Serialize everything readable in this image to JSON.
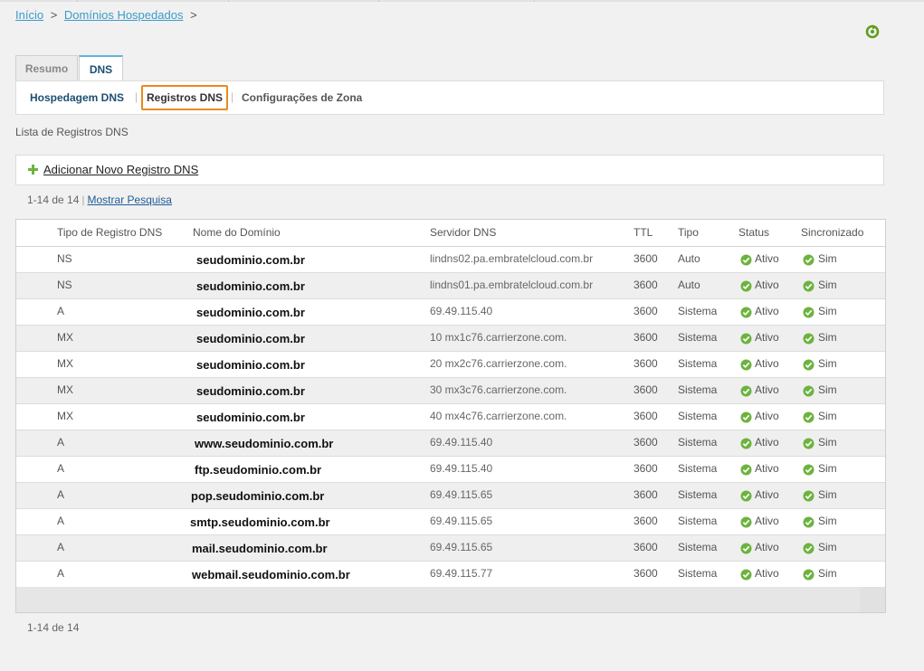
{
  "breadcrumb": {
    "items": [
      "Início",
      "Domínios Hospedados"
    ],
    "separator": ">"
  },
  "icons": {
    "refresh": "refresh-icon",
    "add": "plus-icon",
    "status_ok": "check-circle-icon"
  },
  "colors": {
    "link": "#3a9bc9",
    "tab_active_text": "#1d4f73",
    "highlight_border": "#e98a1b",
    "ok_green": "#6db33f"
  },
  "tabs": [
    {
      "label": "Resumo",
      "active": false
    },
    {
      "label": "DNS",
      "active": true
    }
  ],
  "subnav": {
    "items": [
      {
        "label": "Hospedagem DNS",
        "active": false
      },
      {
        "label": "Registros DNS",
        "active": true
      },
      {
        "label": "Configurações de Zona",
        "active": false
      }
    ],
    "separator": "|"
  },
  "list_title": "Lista de Registros DNS",
  "add_record_label": "Adicionar Novo Registro DNS",
  "paging": {
    "range": "1-14 de 14",
    "separator": "|",
    "search_link": "Mostrar Pesquisa",
    "bottom_range": "1-14 de 14"
  },
  "table": {
    "columns": [
      "Tipo de Registro DNS",
      "Nome do Domínio",
      "Servidor DNS",
      "TTL",
      "Tipo",
      "Status",
      "Sincronizado"
    ],
    "rows": [
      {
        "type": "NS",
        "name": "seudominio.com.br",
        "server": "lindns02.pa.embratelcloud.com.br",
        "ttl": "3600",
        "kind": "Auto",
        "status": "Ativo",
        "sync": "Sim"
      },
      {
        "type": "NS",
        "name": "seudominio.com.br",
        "server": "lindns01.pa.embratelcloud.com.br",
        "ttl": "3600",
        "kind": "Auto",
        "status": "Ativo",
        "sync": "Sim"
      },
      {
        "type": "A",
        "name": "seudominio.com.br",
        "server": "69.49.115.40",
        "ttl": "3600",
        "kind": "Sistema",
        "status": "Ativo",
        "sync": "Sim"
      },
      {
        "type": "MX",
        "name": "seudominio.com.br",
        "server": "10 mx1c76.carrierzone.com.",
        "ttl": "3600",
        "kind": "Sistema",
        "status": "Ativo",
        "sync": "Sim"
      },
      {
        "type": "MX",
        "name": "seudominio.com.br",
        "server": "20 mx2c76.carrierzone.com.",
        "ttl": "3600",
        "kind": "Sistema",
        "status": "Ativo",
        "sync": "Sim"
      },
      {
        "type": "MX",
        "name": "seudominio.com.br",
        "server": "30 mx3c76.carrierzone.com.",
        "ttl": "3600",
        "kind": "Sistema",
        "status": "Ativo",
        "sync": "Sim"
      },
      {
        "type": "MX",
        "name": "seudominio.com.br",
        "server": "40 mx4c76.carrierzone.com.",
        "ttl": "3600",
        "kind": "Sistema",
        "status": "Ativo",
        "sync": "Sim"
      },
      {
        "type": "A",
        "name": "www.seudominio.com.br",
        "server": "69.49.115.40",
        "ttl": "3600",
        "kind": "Sistema",
        "status": "Ativo",
        "sync": "Sim"
      },
      {
        "type": "A",
        "name": "ftp.seudominio.com.br",
        "server": "69.49.115.40",
        "ttl": "3600",
        "kind": "Sistema",
        "status": "Ativo",
        "sync": "Sim"
      },
      {
        "type": "A",
        "name": "pop.seudominio.com.br",
        "server": "69.49.115.65",
        "ttl": "3600",
        "kind": "Sistema",
        "status": "Ativo",
        "sync": "Sim"
      },
      {
        "type": "A",
        "name": "smtp.seudominio.com.br",
        "server": "69.49.115.65",
        "ttl": "3600",
        "kind": "Sistema",
        "status": "Ativo",
        "sync": "Sim"
      },
      {
        "type": "A",
        "name": "mail.seudominio.com.br",
        "server": "69.49.115.65",
        "ttl": "3600",
        "kind": "Sistema",
        "status": "Ativo",
        "sync": "Sim"
      },
      {
        "type": "A",
        "name": "webmail.seudominio.com.br",
        "server": "69.49.115.77",
        "ttl": "3600",
        "kind": "Sistema",
        "status": "Ativo",
        "sync": "Sim"
      }
    ]
  }
}
